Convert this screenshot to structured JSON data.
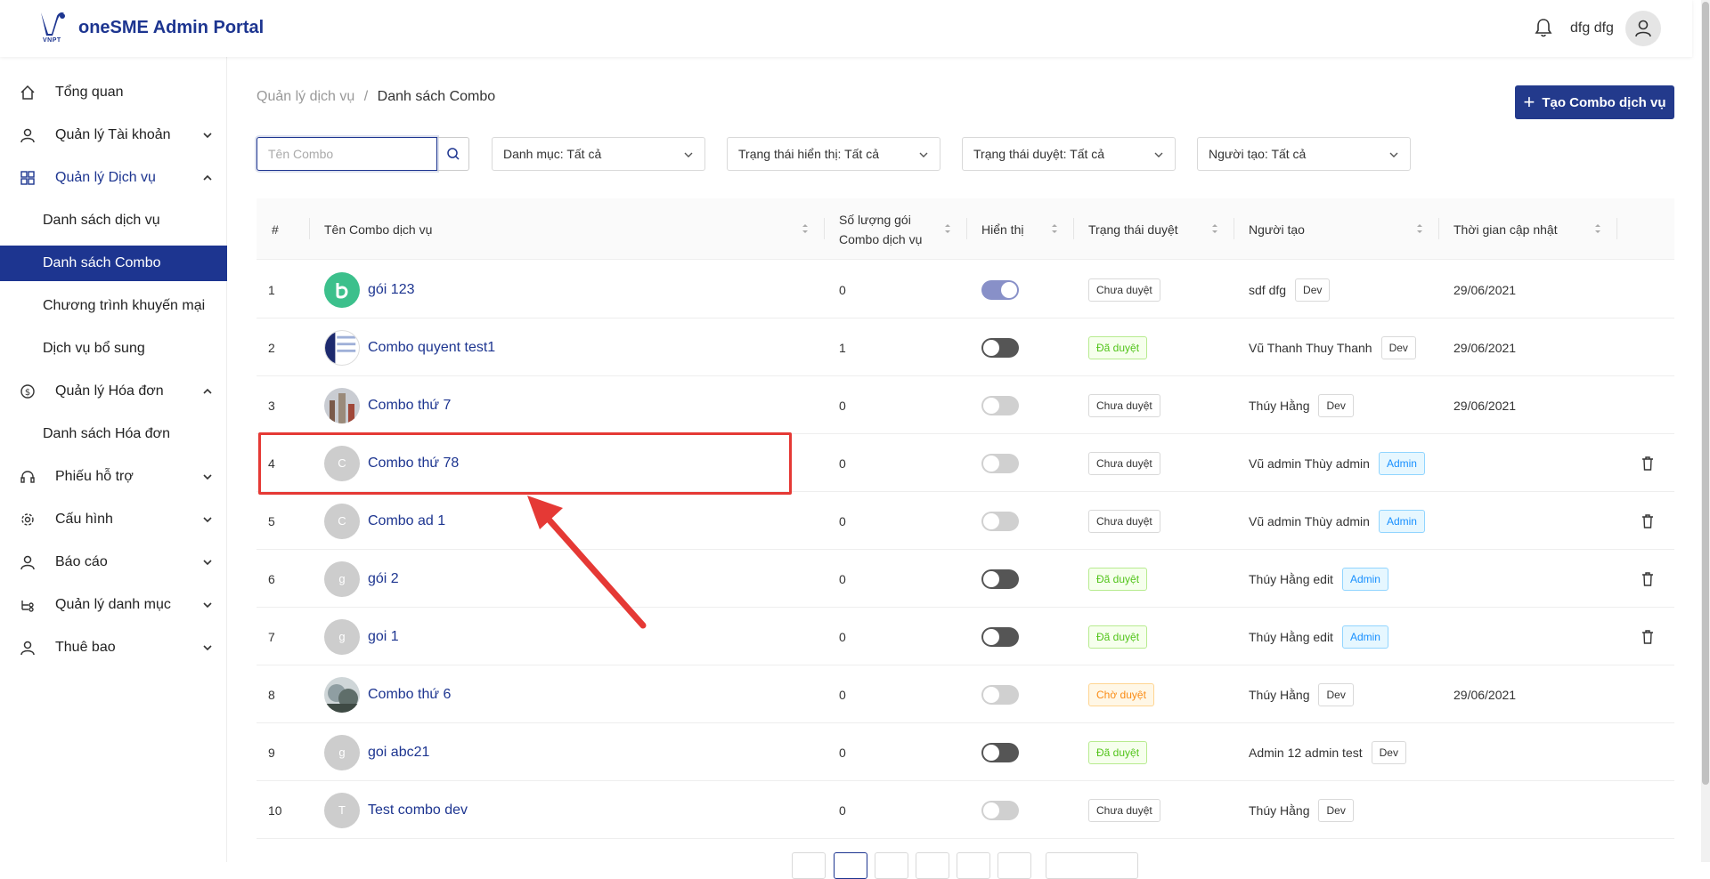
{
  "header": {
    "logo_text": "VNPT",
    "app_title": "oneSME Admin Portal",
    "user_name": "dfg dfg"
  },
  "sidebar": {
    "items": [
      {
        "label": "Tổng quan",
        "icon": "home-icon"
      },
      {
        "label": "Quản lý Tài khoản",
        "icon": "user-icon"
      },
      {
        "label": "Quản lý Dịch vụ",
        "icon": "grid-icon"
      },
      {
        "label": "Danh sách dịch vụ"
      },
      {
        "label": "Danh sách Combo"
      },
      {
        "label": "Chương trình khuyến mại"
      },
      {
        "label": "Dịch vụ bổ sung"
      },
      {
        "label": "Quản lý Hóa đơn",
        "icon": "dollar-icon"
      },
      {
        "label": "Danh sách Hóa đơn"
      },
      {
        "label": "Phiếu hỗ trợ",
        "icon": "headset-icon"
      },
      {
        "label": "Cấu hình",
        "icon": "gear-icon"
      },
      {
        "label": "Báo cáo",
        "icon": "user-icon"
      },
      {
        "label": "Quản lý danh mục",
        "icon": "category-icon"
      },
      {
        "label": "Thuê bao",
        "icon": "user-icon"
      }
    ]
  },
  "breadcrumb": {
    "parent": "Quản lý dịch vụ",
    "separator": "/",
    "current": "Danh sách Combo"
  },
  "toolbar": {
    "create_label": "Tạo Combo dịch vụ",
    "search_placeholder": "Tên Combo",
    "filter_category": "Danh mục: Tất cả",
    "filter_display": "Trạng thái hiển thị: Tất cả",
    "filter_approval": "Trạng thái duyệt: Tất cả",
    "filter_creator": "Người tạo: Tất cả"
  },
  "table": {
    "headers": {
      "index": "#",
      "name": "Tên Combo dịch vụ",
      "count_line1": "Số lượng gói",
      "count_line2": "Combo dịch vụ",
      "display": "Hiển thị",
      "approval": "Trạng thái duyệt",
      "creator": "Người tạo",
      "updated": "Thời gian cập nhật"
    },
    "rows": [
      {
        "index": "1",
        "avatar": "b",
        "name": "gói 123",
        "count": "0",
        "toggle": "on-blue",
        "status": "Chưa duyệt",
        "status_type": "default",
        "creator": "sdf dfg",
        "role": "Dev",
        "updated": "29/06/2021",
        "trash": false
      },
      {
        "index": "2",
        "avatar": "",
        "name": "Combo quyent test1",
        "count": "1",
        "toggle": "off-dark",
        "status": "Đã duyệt",
        "status_type": "green",
        "creator": "Vũ Thanh Thuy Thanh",
        "role": "Dev",
        "updated": "29/06/2021",
        "trash": false
      },
      {
        "index": "3",
        "avatar": "",
        "name": "Combo thứ 7",
        "count": "0",
        "toggle": "off-light",
        "status": "Chưa duyệt",
        "status_type": "default",
        "creator": "Thúy Hằng",
        "role": "Dev",
        "updated": "29/06/2021",
        "trash": false
      },
      {
        "index": "4",
        "avatar": "C",
        "name": "Combo thứ 78",
        "count": "0",
        "toggle": "off-light",
        "status": "Chưa duyệt",
        "status_type": "default",
        "creator": "Vũ admin Thùy admin",
        "role": "Admin",
        "updated": "",
        "trash": true
      },
      {
        "index": "5",
        "avatar": "C",
        "name": "Combo ad 1",
        "count": "0",
        "toggle": "off-light",
        "status": "Chưa duyệt",
        "status_type": "default",
        "creator": "Vũ admin Thùy admin",
        "role": "Admin",
        "updated": "",
        "trash": true
      },
      {
        "index": "6",
        "avatar": "g",
        "name": "gói 2",
        "count": "0",
        "toggle": "off-dark",
        "status": "Đã duyệt",
        "status_type": "green",
        "creator": "Thúy Hằng edit",
        "role": "Admin",
        "updated": "",
        "trash": true
      },
      {
        "index": "7",
        "avatar": "g",
        "name": "goi 1",
        "count": "0",
        "toggle": "off-dark",
        "status": "Đã duyệt",
        "status_type": "green",
        "creator": "Thúy Hằng edit",
        "role": "Admin",
        "updated": "",
        "trash": true
      },
      {
        "index": "8",
        "avatar": "",
        "name": "Combo thứ 6",
        "count": "0",
        "toggle": "off-light",
        "status": "Chờ duyệt",
        "status_type": "orange",
        "creator": "Thúy Hằng",
        "role": "Dev",
        "updated": "29/06/2021",
        "trash": false
      },
      {
        "index": "9",
        "avatar": "g",
        "name": "goi abc21",
        "count": "0",
        "toggle": "off-dark",
        "status": "Đã duyệt",
        "status_type": "green",
        "creator": "Admin 12 admin test",
        "role": "Dev",
        "updated": "",
        "trash": false
      },
      {
        "index": "10",
        "avatar": "T",
        "name": "Test combo dev",
        "count": "0",
        "toggle": "off-light",
        "status": "Chưa duyệt",
        "status_type": "default",
        "creator": "Thúy Hằng",
        "role": "Dev",
        "updated": "",
        "trash": false
      }
    ]
  },
  "colors": {
    "primary": "#1d3590",
    "annotation": "#e53935"
  }
}
